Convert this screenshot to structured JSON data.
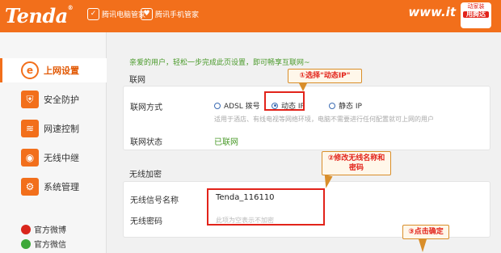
{
  "header": {
    "logo": "Tenda",
    "partner1": "腾讯电脑管家",
    "partner2": "腾讯手机管家",
    "site": "www.it",
    "badge_top": "动家装",
    "badge_main": "用腾达"
  },
  "sidebar": {
    "items": [
      {
        "label": "上网设置",
        "icon": "internet-icon"
      },
      {
        "label": "安全防护",
        "icon": "shield-icon"
      },
      {
        "label": "网速控制",
        "icon": "speed-icon"
      },
      {
        "label": "无线中继",
        "icon": "wireless-relay-icon"
      },
      {
        "label": "系统管理",
        "icon": "gear-icon"
      }
    ],
    "weibo": "官方微博",
    "wechat": "官方微信"
  },
  "main": {
    "welcome": "亲爱的用户，轻松一步完成此页设置，即可畅享互联网~",
    "network_section": "联网",
    "conn_type_label": "联网方式",
    "options": [
      "ADSL 拨号",
      "动态 IP",
      "静态 IP"
    ],
    "selected_option": "动态 IP",
    "hint": "适用于酒店、有线电视等网络环境，电脑不需要进行任何配置就可上网的用户",
    "status_label": "联网状态",
    "status_value": "已联网",
    "wireless_section": "无线加密",
    "ssid_label": "无线信号名称",
    "ssid_value": "Tenda_116110",
    "password_label": "无线密码",
    "password_placeholder": "此项为空表示不加密"
  },
  "annotations": {
    "step1": "①选择\"动态IP\"",
    "step2": "②修改无线名称和密码",
    "step3": "③点击确定"
  },
  "colors": {
    "brand": "#f26f1b",
    "annotation": "#e2231a",
    "status": "#4a9a2a"
  }
}
